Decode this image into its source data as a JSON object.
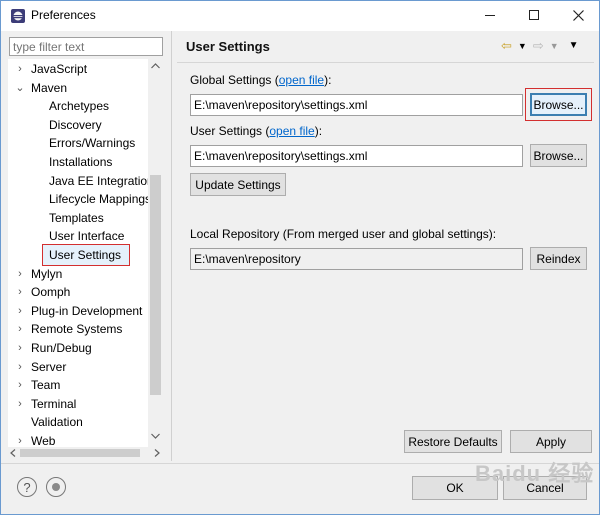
{
  "window": {
    "title": "Preferences"
  },
  "left": {
    "filter_placeholder": "type filter text",
    "tree": [
      {
        "label": "JavaScript",
        "twisty": "›",
        "indent": 0
      },
      {
        "label": "Maven",
        "twisty": "⌄",
        "indent": 0
      },
      {
        "label": "Archetypes",
        "twisty": "",
        "indent": 1
      },
      {
        "label": "Discovery",
        "twisty": "",
        "indent": 1
      },
      {
        "label": "Errors/Warnings",
        "twisty": "",
        "indent": 1
      },
      {
        "label": "Installations",
        "twisty": "",
        "indent": 1
      },
      {
        "label": "Java EE Integration",
        "twisty": "",
        "indent": 1
      },
      {
        "label": "Lifecycle Mappings",
        "twisty": "",
        "indent": 1
      },
      {
        "label": "Templates",
        "twisty": "",
        "indent": 1
      },
      {
        "label": "User Interface",
        "twisty": "",
        "indent": 1
      },
      {
        "label": "User Settings",
        "twisty": "",
        "indent": 1,
        "selected": true
      },
      {
        "label": "Mylyn",
        "twisty": "›",
        "indent": 0
      },
      {
        "label": "Oomph",
        "twisty": "›",
        "indent": 0
      },
      {
        "label": "Plug-in Development",
        "twisty": "›",
        "indent": 0
      },
      {
        "label": "Remote Systems",
        "twisty": "›",
        "indent": 0
      },
      {
        "label": "Run/Debug",
        "twisty": "›",
        "indent": 0
      },
      {
        "label": "Server",
        "twisty": "›",
        "indent": 0
      },
      {
        "label": "Team",
        "twisty": "›",
        "indent": 0
      },
      {
        "label": "Terminal",
        "twisty": "›",
        "indent": 0
      },
      {
        "label": "Validation",
        "twisty": "",
        "indent": 0
      },
      {
        "label": "Web",
        "twisty": "›",
        "indent": 0
      }
    ]
  },
  "page": {
    "title": "User Settings",
    "global_label_pre": "Global Settings (",
    "global_link": "open file",
    "global_label_post": "):",
    "global_path": "E:\\maven\\repository\\settings.xml",
    "user_label_pre": "User Settings (",
    "user_link": "open file",
    "user_label_post": "):",
    "user_path": "E:\\maven\\repository\\settings.xml",
    "browse": "Browse...",
    "update_settings": "Update Settings",
    "local_repo_label": "Local Repository (From merged user and global settings):",
    "local_repo_path": "E:\\maven\\repository",
    "reindex": "Reindex",
    "restore_defaults": "Restore Defaults",
    "apply": "Apply"
  },
  "footer": {
    "ok": "OK",
    "cancel": "Cancel"
  },
  "watermark": "Baidu 经验"
}
